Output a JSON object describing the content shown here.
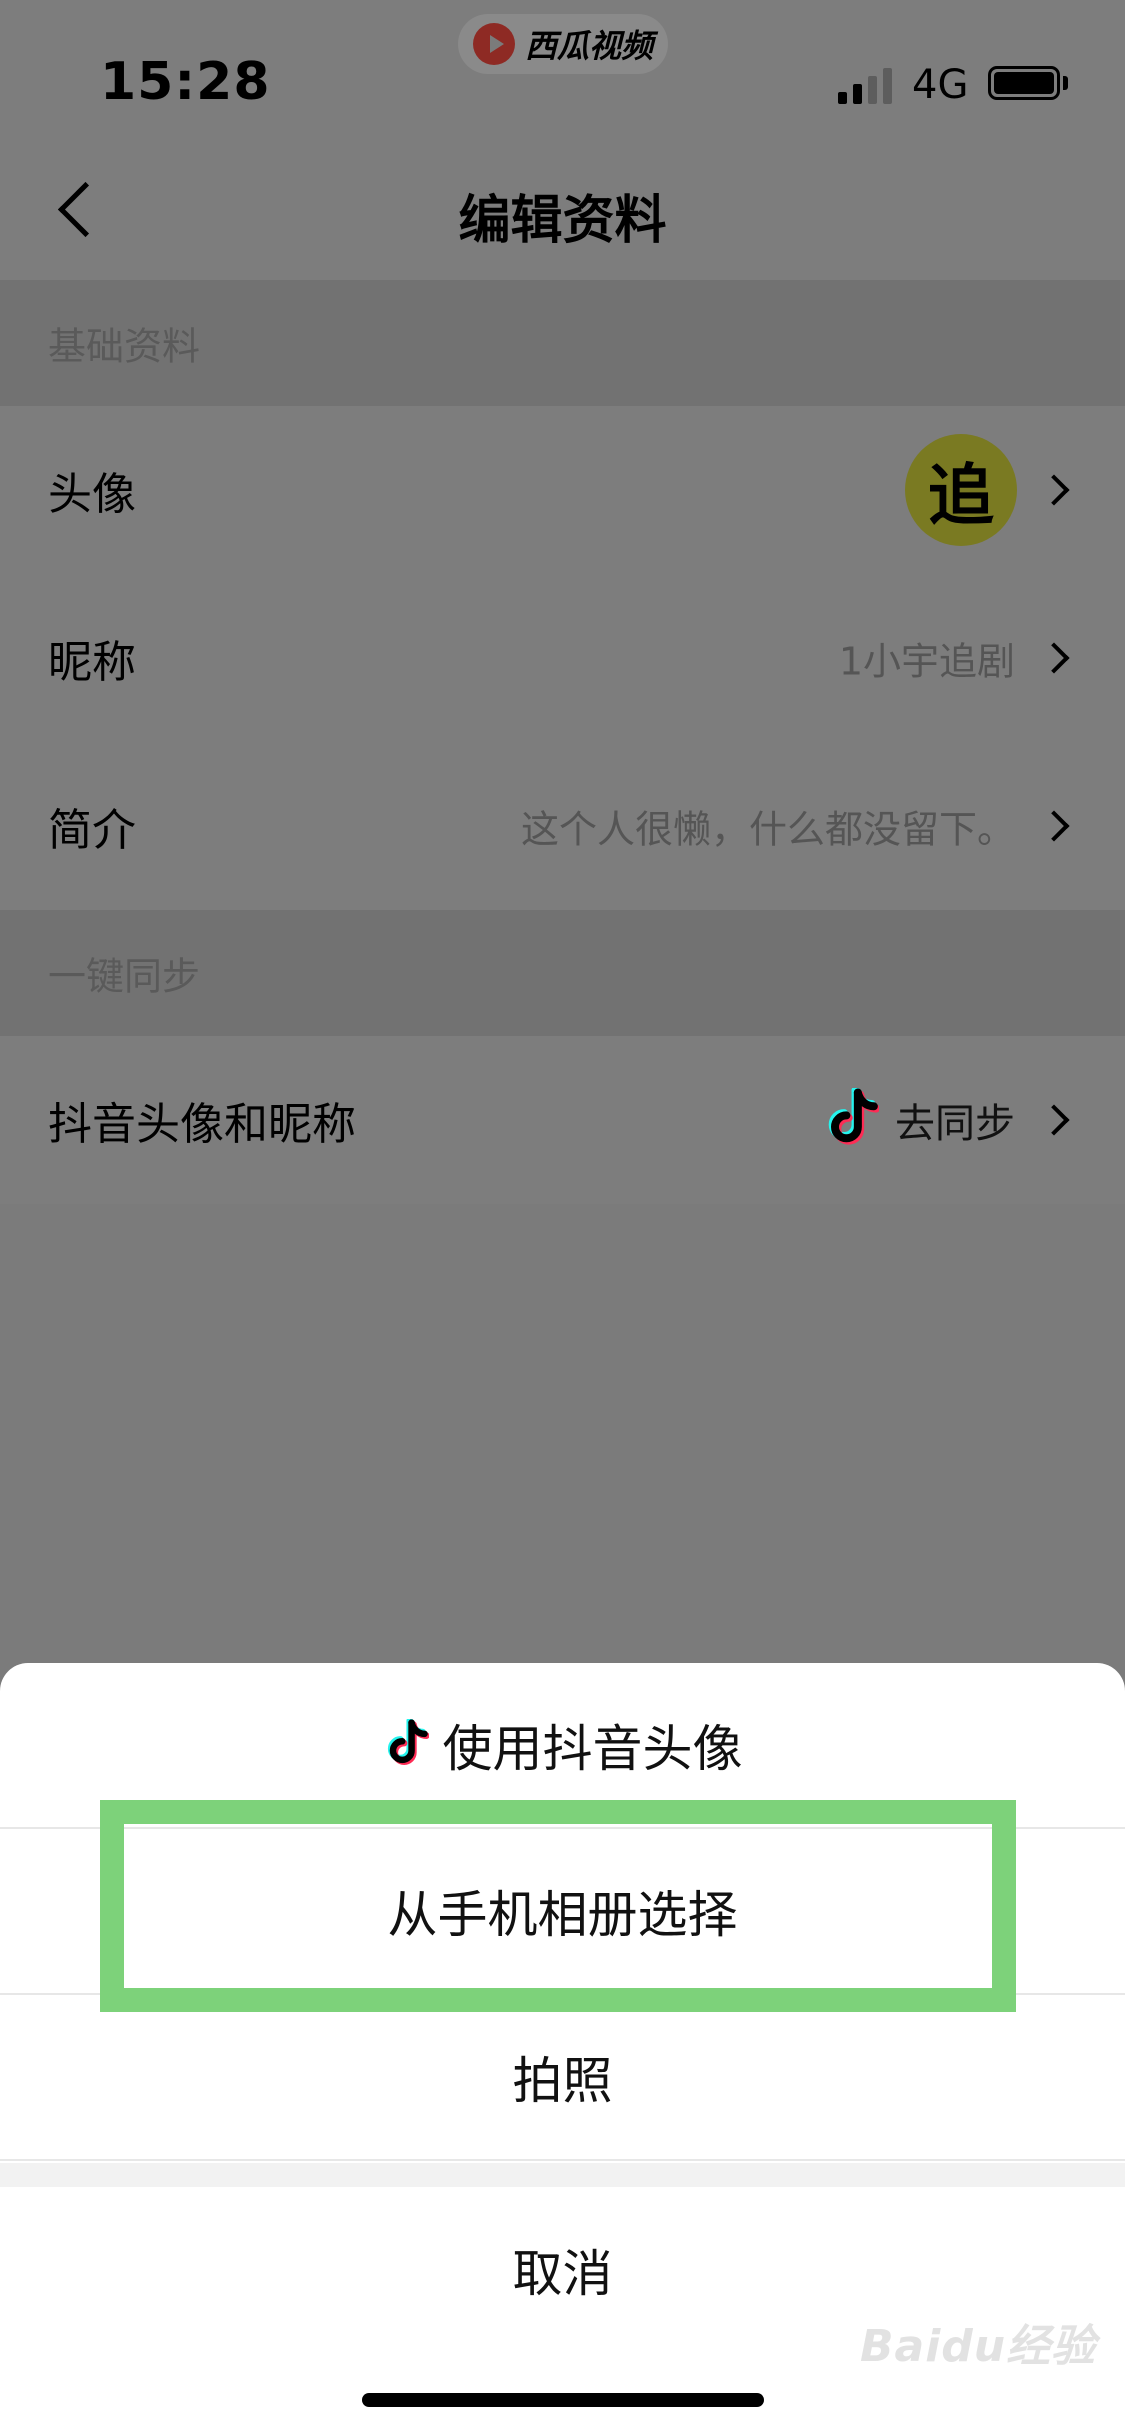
{
  "status_bar": {
    "time": "15:28",
    "app_badge": "西瓜视频",
    "network": "4G"
  },
  "nav": {
    "title": "编辑资料"
  },
  "sections": {
    "basic_header": "基础资料",
    "sync_header": "一键同步"
  },
  "rows": {
    "avatar_label": "头像",
    "avatar_glyph": "追",
    "nickname_label": "昵称",
    "nickname_value": "1小宇追剧",
    "bio_label": "简介",
    "bio_value": "这个人很懒，什么都没留下。",
    "douyin_label": "抖音头像和昵称",
    "douyin_action": "去同步"
  },
  "action_sheet": {
    "use_douyin_avatar": "使用抖音头像",
    "choose_from_album": "从手机相册选择",
    "take_photo": "拍照",
    "cancel": "取消"
  },
  "watermark": "Baidu经验",
  "colors": {
    "highlight": "#7dd27a",
    "overlay": "#7b7b7b",
    "sheet_bg": "#ffffff"
  }
}
